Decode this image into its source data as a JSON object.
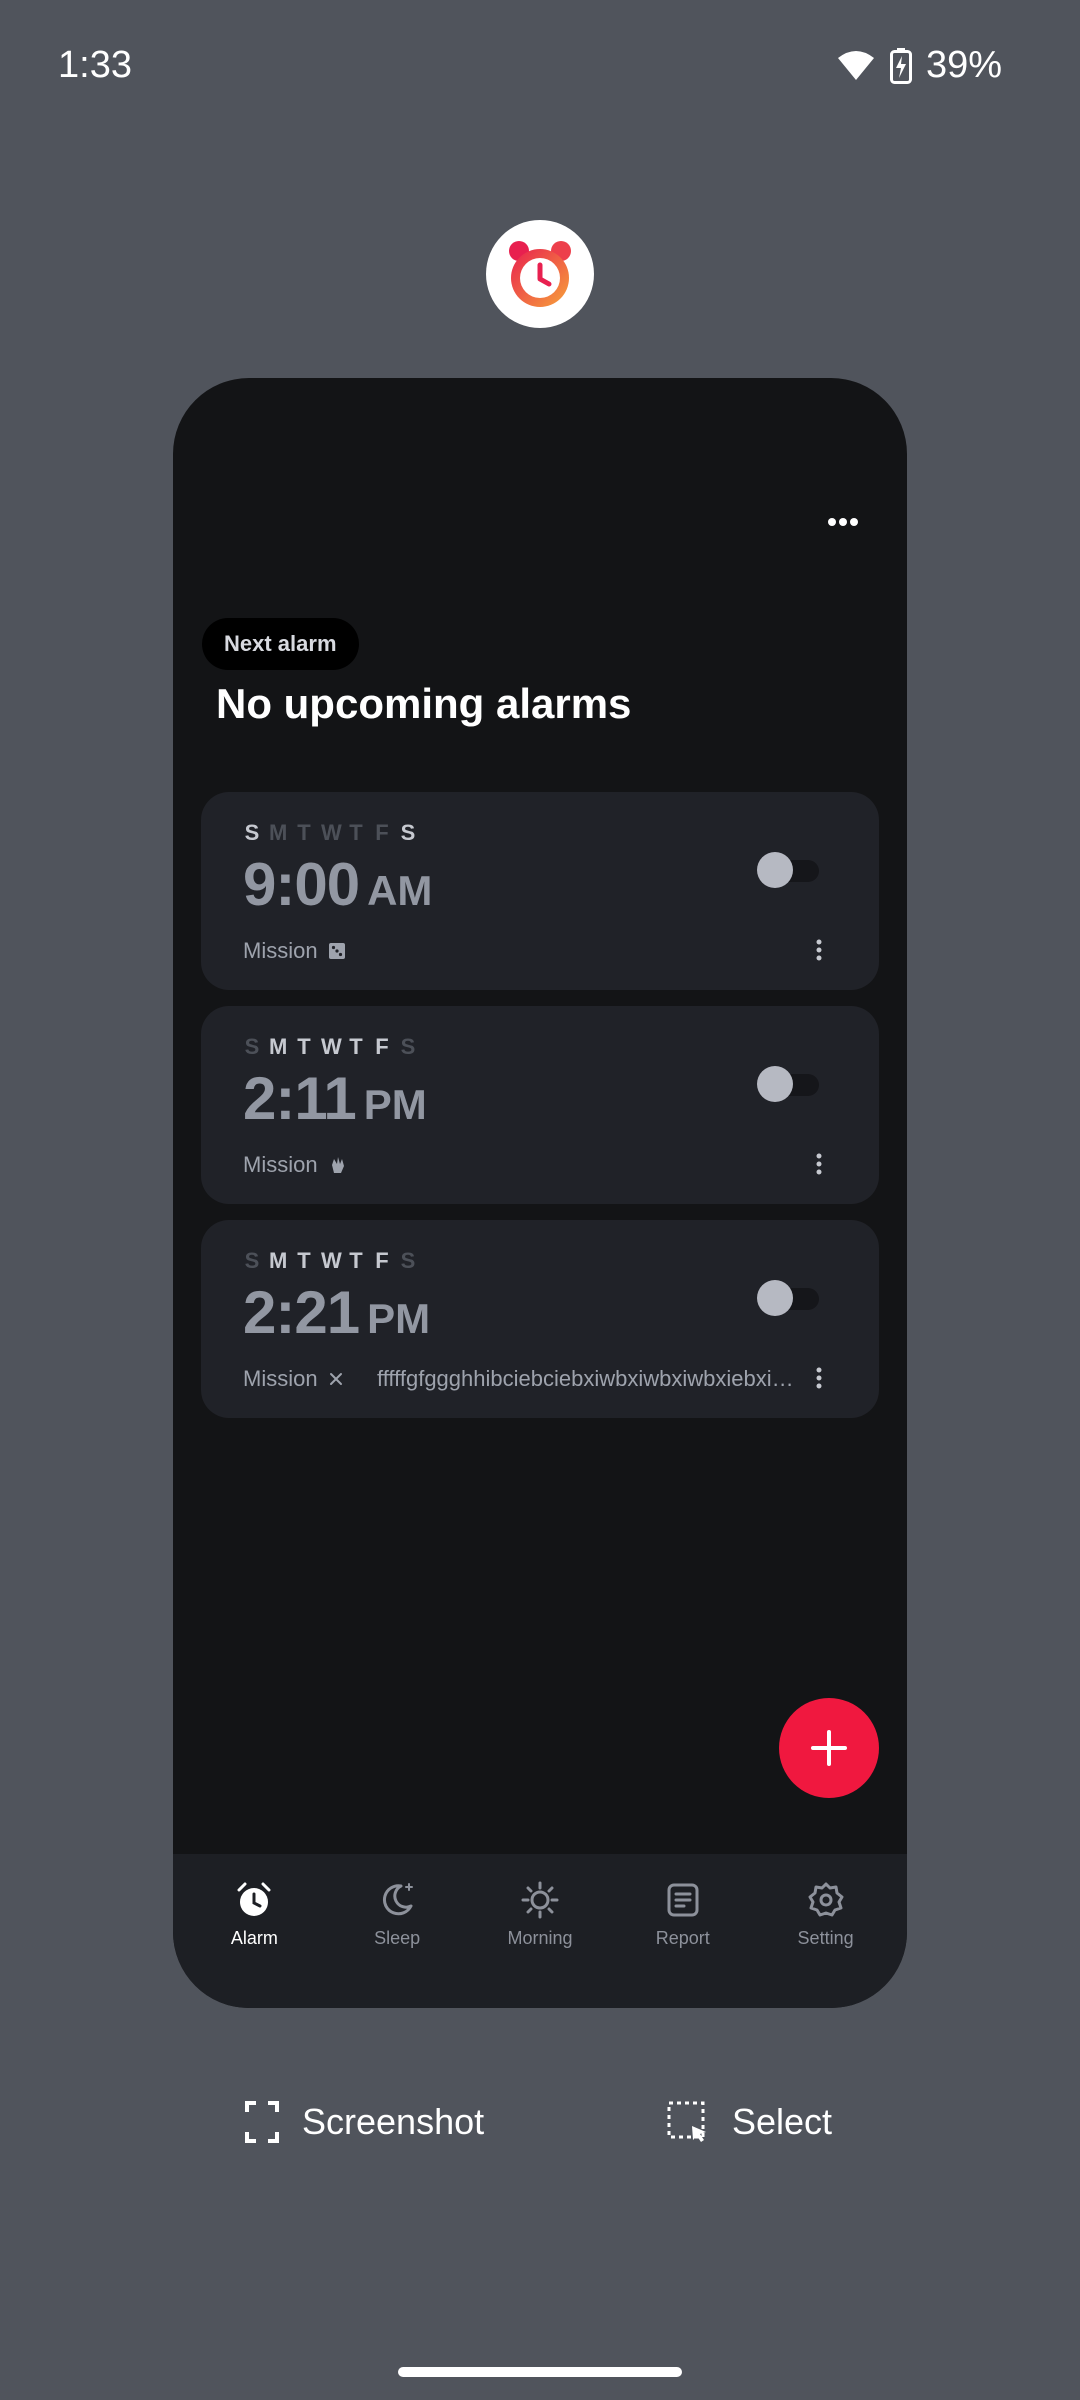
{
  "status_bar": {
    "time": "1:33",
    "battery": "39%",
    "icons": [
      "wifi-icon",
      "battery-charging-icon"
    ]
  },
  "app": {
    "icon": "alarm-clock-icon",
    "brand_colors": [
      "#e8204f",
      "#f7a23a"
    ]
  },
  "header": {
    "more_icon": "more-horizontal-icon",
    "next_alarm_label": "Next alarm",
    "title": "No upcoming alarms"
  },
  "alarms": [
    {
      "days": [
        "S",
        "M",
        "T",
        "W",
        "T",
        "F",
        "S"
      ],
      "active_days": [
        true,
        false,
        false,
        false,
        false,
        false,
        true
      ],
      "time": "9:00",
      "period": "AM",
      "enabled": false,
      "mission_label": "Mission",
      "mission_icon": "dice-icon",
      "extra": ""
    },
    {
      "days": [
        "S",
        "M",
        "T",
        "W",
        "T",
        "F",
        "S"
      ],
      "active_days": [
        false,
        true,
        true,
        true,
        true,
        true,
        false
      ],
      "time": "2:11",
      "period": "PM",
      "enabled": false,
      "mission_label": "Mission",
      "mission_icon": "shake-hand-icon",
      "extra": ""
    },
    {
      "days": [
        "S",
        "M",
        "T",
        "W",
        "T",
        "F",
        "S"
      ],
      "active_days": [
        false,
        true,
        true,
        true,
        true,
        true,
        false
      ],
      "time": "2:21",
      "period": "PM",
      "enabled": false,
      "mission_label": "Mission",
      "mission_icon": "close-icon",
      "extra": "fffffgfggghhibciebciebxiwbxiwbxiwbxiebxie..."
    }
  ],
  "fab": {
    "icon": "plus-icon",
    "color": "#f0183f"
  },
  "nav": [
    {
      "label": "Alarm",
      "icon": "alarm-icon",
      "active": true
    },
    {
      "label": "Sleep",
      "icon": "moon-icon",
      "active": false
    },
    {
      "label": "Morning",
      "icon": "sun-icon",
      "active": false
    },
    {
      "label": "Report",
      "icon": "report-icon",
      "active": false
    },
    {
      "label": "Setting",
      "icon": "gear-icon",
      "active": false
    }
  ],
  "actions": {
    "screenshot_label": "Screenshot",
    "select_label": "Select"
  }
}
